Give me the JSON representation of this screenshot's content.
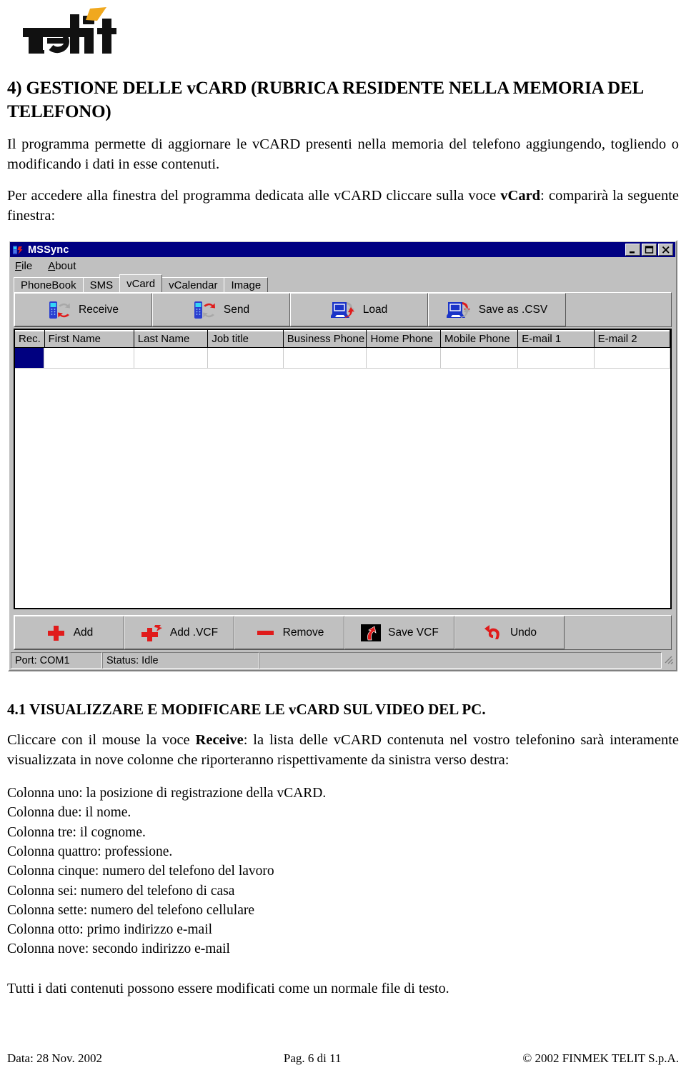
{
  "brand": {
    "name": "Telit"
  },
  "document": {
    "title": "4) GESTIONE DELLE vCARD (RUBRICA RESIDENTE NELLA MEMORIA DEL TELEFONO)",
    "intro_1": "Il programma permette di aggiornare le vCARD presenti nella memoria del telefono aggiungendo, togliendo o modificando i dati in esse contenuti.",
    "intro_2_a": "Per accedere alla finestra del programma dedicata alle vCARD cliccare sulla voce ",
    "intro_2_bold": "vCard",
    "intro_2_b": ": comparirà la seguente finestra:",
    "section_title": "4.1 VISUALIZZARE E MODIFICARE LE vCARD SUL VIDEO DEL PC.",
    "section_para_a": "Cliccare con il mouse la voce ",
    "section_para_bold": "Receive",
    "section_para_b": ": la lista delle vCARD contenuta nel vostro telefonino sarà interamente visualizzata in nove colonne che riporteranno rispettivamente da sinistra verso destra:",
    "columns_list": [
      "Colonna uno: la posizione di registrazione della vCARD.",
      "Colonna due: il nome.",
      "Colonna tre: il cognome.",
      "Colonna quattro: professione.",
      "Colonna cinque: numero del telefono del lavoro",
      "Colonna sei: numero del telefono di casa",
      "Colonna sette: numero del telefono cellulare",
      "Colonna otto: primo indirizzo e-mail",
      "Colonna nove: secondo indirizzo e-mail"
    ],
    "closing": "Tutti i dati contenuti possono essere modificati come un normale file di testo."
  },
  "footer": {
    "date": "Data: 28 Nov. 2002",
    "page": "Pag. 6 di 11",
    "copyright": "© 2002 FINMEK TELIT S.p.A."
  },
  "app": {
    "title": "MSSync",
    "title_icon": "phone-sync-icon",
    "window_buttons": [
      {
        "name": "minimize-button",
        "glyph": "minimize-icon"
      },
      {
        "name": "maximize-button",
        "glyph": "maximize-icon"
      },
      {
        "name": "close-button",
        "glyph": "close-icon"
      }
    ],
    "menu": [
      {
        "label": "File",
        "mnemonic": "F"
      },
      {
        "label": "About",
        "mnemonic": "A"
      }
    ],
    "tabs": [
      {
        "label": "PhoneBook",
        "active": false
      },
      {
        "label": "SMS",
        "active": false
      },
      {
        "label": "vCard",
        "active": true
      },
      {
        "label": "vCalendar",
        "active": false
      },
      {
        "label": "Image",
        "active": false
      }
    ],
    "toolbar": [
      {
        "label": "Receive",
        "icon": "phone-receive-icon"
      },
      {
        "label": "Send",
        "icon": "phone-send-icon"
      },
      {
        "label": "Load",
        "icon": "computer-load-icon"
      },
      {
        "label": "Save as .CSV",
        "icon": "computer-save-icon"
      }
    ],
    "grid": {
      "headers": [
        "Rec.",
        "First Name",
        "Last Name",
        "Job title",
        "Business Phone",
        "Home Phone",
        "Mobile Phone",
        "E-mail 1",
        "E-mail 2"
      ],
      "rows": [
        {
          "selected_index": 0,
          "cells": [
            "",
            "",
            "",
            "",
            "",
            "",
            "",
            "",
            ""
          ]
        }
      ]
    },
    "bottom_buttons": [
      {
        "label": "Add",
        "icon": "plus-icon"
      },
      {
        "label": "Add .VCF",
        "icon": "plus-arrow-icon"
      },
      {
        "label": "Remove",
        "icon": "minus-icon"
      },
      {
        "label": "Save VCF",
        "icon": "save-arrow-icon"
      },
      {
        "label": "Undo",
        "icon": "undo-icon"
      }
    ],
    "status": {
      "port": "Port: COM1",
      "state": "Status: Idle",
      "extra": ""
    },
    "colors": {
      "titlebar": "#000082",
      "face": "#c0c0c0",
      "selection": "#000080",
      "accent_red": "#e01b1b",
      "accent_blue": "#1b35c8"
    }
  }
}
